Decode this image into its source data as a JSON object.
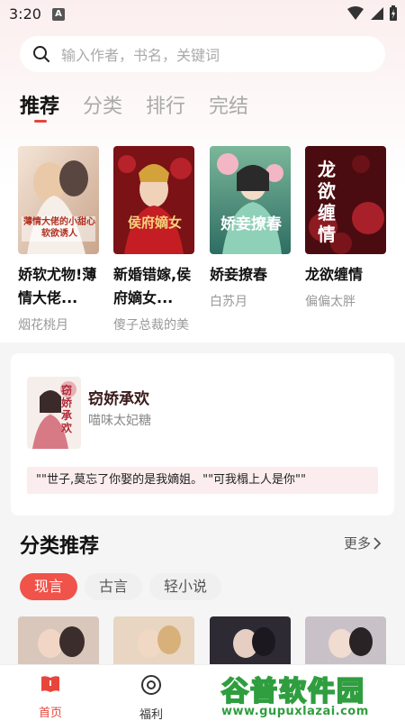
{
  "status_bar": {
    "time": "3:20",
    "notif_badge": "A"
  },
  "search": {
    "placeholder": "输入作者，书名，关键词"
  },
  "tabs": [
    {
      "label": "推荐",
      "active": true
    },
    {
      "label": "分类",
      "active": false
    },
    {
      "label": "排行",
      "active": false
    },
    {
      "label": "完结",
      "active": false
    }
  ],
  "books": [
    {
      "title": "娇软尤物!薄情大佬...",
      "author": "烟花桃月",
      "cover_text": "薄情大佬的小甜心软欲诱人"
    },
    {
      "title": "新婚错嫁,侯府嫡女...",
      "author": "傻子总裁的美",
      "cover_text": "侯府嫡女"
    },
    {
      "title": "娇妾撩春",
      "author": "白苏月",
      "cover_text": "娇妾撩春"
    },
    {
      "title": "龙欲缠情",
      "author": "偏偏太胖",
      "cover_text": "龙欲缠情"
    }
  ],
  "feature": {
    "title": "窃娇承欢",
    "author": "喵味太妃糖",
    "quote": "\"\"世子,莫忘了你娶的是我嫡姐。\"\"可我榻上人是你\"\"",
    "cover_text": "窃娇承欢"
  },
  "category": {
    "title": "分类推荐",
    "more_label": "更多",
    "chips": [
      {
        "label": "现言",
        "active": true
      },
      {
        "label": "古言",
        "active": false
      },
      {
        "label": "轻小说",
        "active": false
      }
    ]
  },
  "bottom_nav": [
    {
      "label": "首页",
      "icon": "book-icon",
      "active": true
    },
    {
      "label": "福利",
      "icon": "target-icon",
      "active": false
    }
  ],
  "watermark": {
    "cn": "谷普软件园",
    "url": "www.gupuxlazai.com"
  },
  "colors": {
    "accent": "#e8453c",
    "chip_active": "#f0534a",
    "watermark": "#2f9e3f"
  }
}
